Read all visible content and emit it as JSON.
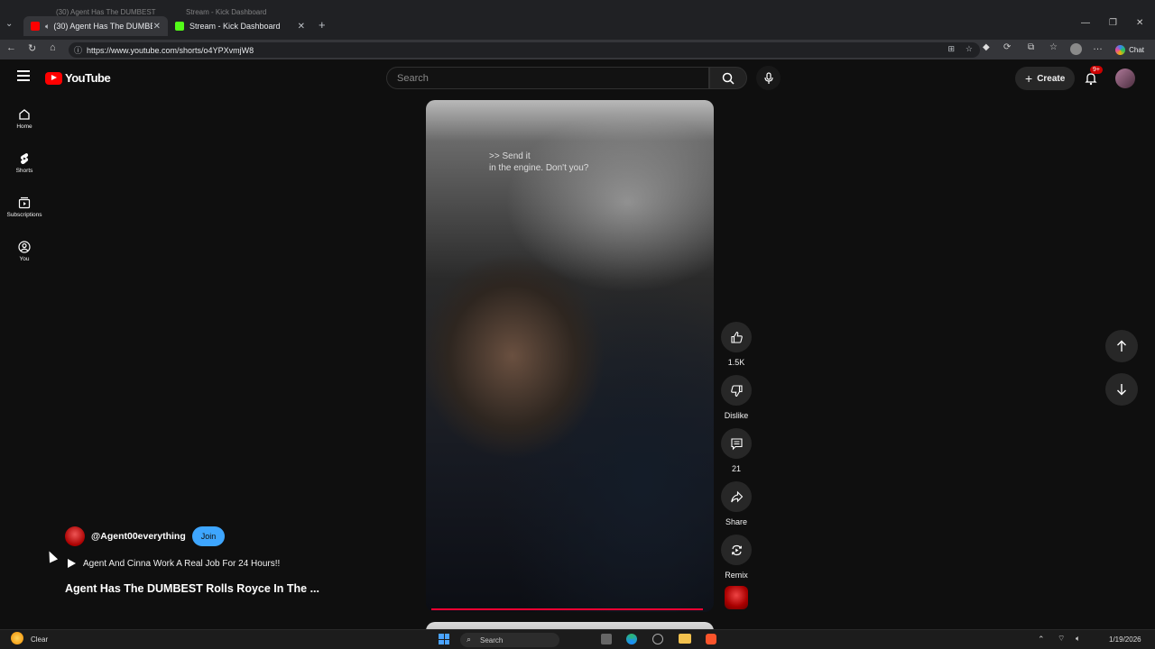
{
  "browser": {
    "tabs": [
      {
        "title": "(30) Agent Has The DUMBEST",
        "active": true
      },
      {
        "title": "Stream - Kick Dashboard",
        "active": false
      }
    ],
    "ghost_tabs": [
      {
        "title": "(30) Agent Has The DUMBEST"
      },
      {
        "title": "Stream - Kick Dashboard"
      }
    ],
    "url": "https://www.youtube.com/shorts/o4YPXvmjW8",
    "chat_label": "Chat"
  },
  "header": {
    "logo_text": "YouTube",
    "search_placeholder": "Search",
    "create_label": "Create",
    "notif_badge": "9+"
  },
  "sidebar": {
    "items": [
      {
        "label": "Home",
        "icon": "home-icon"
      },
      {
        "label": "Shorts",
        "icon": "shorts-icon"
      },
      {
        "label": "Subscriptions",
        "icon": "subscriptions-icon"
      },
      {
        "label": "You",
        "icon": "you-icon"
      }
    ]
  },
  "video": {
    "caption_line1": ">> Send it",
    "caption_line2": "in the engine. Don't you?",
    "progress": 0.98
  },
  "actions": {
    "like": "1.5K",
    "dislike": "Dislike",
    "comments": "21",
    "share": "Share",
    "remix": "Remix"
  },
  "channel": {
    "handle": "@Agent00everything",
    "join_label": "Join",
    "playlist": "Agent And Cinna Work A Real Job For 24 Hours!!",
    "title": "Agent Has The DUMBEST Rolls Royce In The ..."
  },
  "taskbar": {
    "weather": "Clear",
    "search": "Search",
    "date": "1/19/2026"
  },
  "colors": {
    "youtube_red": "#ff0000",
    "join_blue": "#3ea6ff",
    "progress": "#ff0033"
  }
}
